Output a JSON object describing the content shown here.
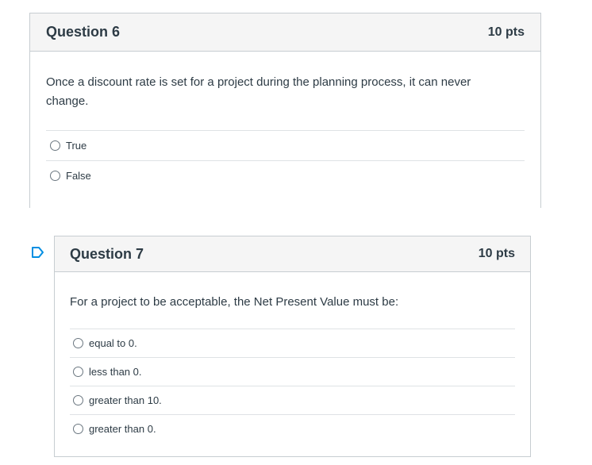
{
  "questions": [
    {
      "title": "Question 6",
      "points": "10 pts",
      "text": "Once a discount rate is set for a project during the planning process, it can never change.",
      "answers": [
        "True",
        "False"
      ]
    },
    {
      "title": "Question 7",
      "points": "10 pts",
      "text": "For a project to be acceptable, the Net Present Value must be:",
      "answers": [
        "equal to 0.",
        "less than 0.",
        "greater than 10.",
        "greater than 0."
      ]
    }
  ],
  "colors": {
    "header_bg": "#f5f5f5",
    "border": "#c7cdd1",
    "text": "#2d3b45",
    "flag_icon": "#008ee2"
  },
  "icons": [
    "flag-icon",
    "radio-icon"
  ]
}
